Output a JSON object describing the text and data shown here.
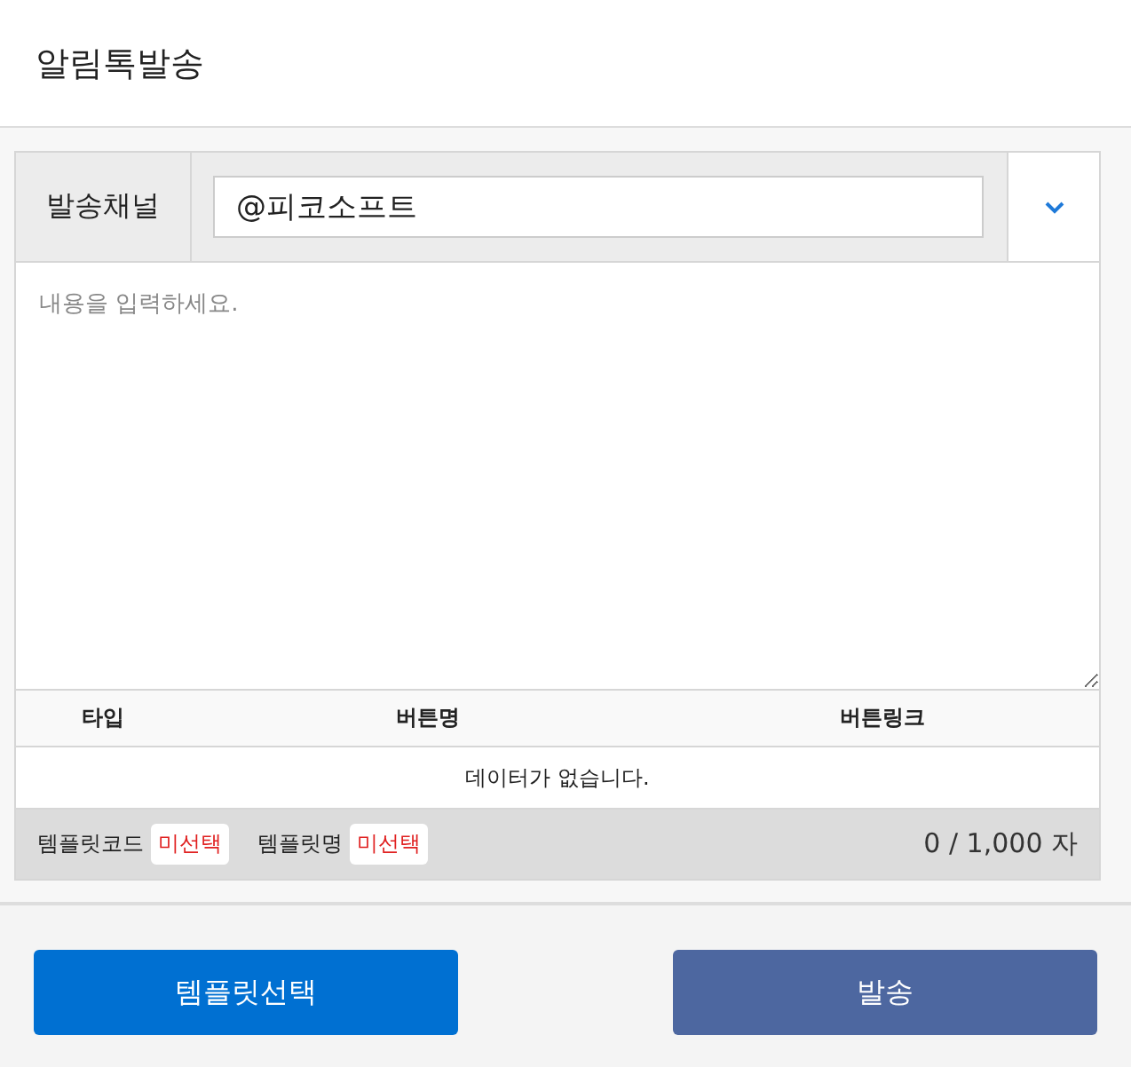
{
  "title": "알림톡발송",
  "channel": {
    "label": "발송채널",
    "value": "@피코소프트"
  },
  "message": {
    "placeholder": "내용을 입력하세요."
  },
  "table": {
    "columns": [
      "타입",
      "버튼명",
      "버튼링크"
    ],
    "empty_text": "데이터가 없습니다."
  },
  "status": {
    "template_code_label": "템플릿코드",
    "template_code_value": "미선택",
    "template_name_label": "템플릿명",
    "template_name_value": "미선택",
    "counter": "0 / 1,000 자"
  },
  "buttons": [
    {
      "label": "템플릿선택",
      "kind": "primary"
    },
    {
      "label": "발송",
      "kind": "secondary"
    }
  ]
}
